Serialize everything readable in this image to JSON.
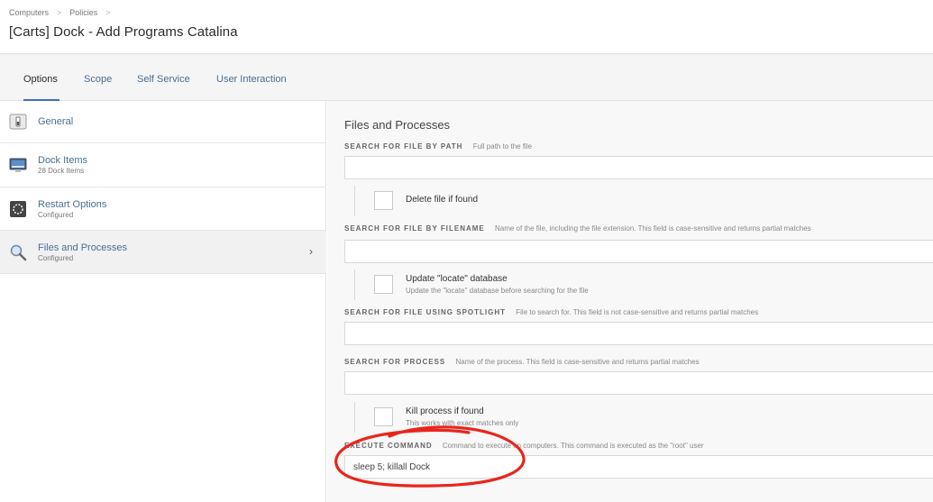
{
  "breadcrumb": {
    "items": [
      "Computers",
      "Policies"
    ],
    "separator": ">"
  },
  "page_title": "[Carts] Dock - Add Programs Catalina",
  "tabs": [
    {
      "label": "Options",
      "active": true
    },
    {
      "label": "Scope",
      "active": false
    },
    {
      "label": "Self Service",
      "active": false
    },
    {
      "label": "User Interaction",
      "active": false
    }
  ],
  "sidebar": {
    "items": [
      {
        "label": "General",
        "sub": "",
        "icon": "general-switch-icon"
      },
      {
        "label": "Dock Items",
        "sub": "28 Dock Items",
        "icon": "monitor-icon"
      },
      {
        "label": "Restart Options",
        "sub": "Configured",
        "icon": "restart-icon"
      },
      {
        "label": "Files and Processes",
        "sub": "Configured",
        "icon": "magnifier-icon",
        "active": true,
        "chevron": "›"
      }
    ]
  },
  "main": {
    "section_title": "Files and Processes",
    "search_path": {
      "label": "SEARCH FOR FILE BY PATH",
      "hint": "Full path to the file",
      "value": ""
    },
    "delete_file": {
      "label": "Delete file if found",
      "checked": false
    },
    "search_filename": {
      "label": "SEARCH FOR FILE BY FILENAME",
      "hint": "Name of the file, including the file extension. This field is case-sensitive and returns partial matches",
      "value": ""
    },
    "update_locate": {
      "label": "Update \"locate\" database",
      "sub": "Update the \"locate\" database before searching for the file",
      "checked": false
    },
    "search_spotlight": {
      "label": "SEARCH FOR FILE USING SPOTLIGHT",
      "hint": "File to search for. This field is not case-sensitive and returns partial matches",
      "value": ""
    },
    "search_process": {
      "label": "SEARCH FOR PROCESS",
      "hint": "Name of the process. This field is case-sensitive and returns partial matches",
      "value": ""
    },
    "kill_process": {
      "label": "Kill process if found",
      "sub": "This works with exact matches only",
      "checked": false
    },
    "execute_command": {
      "label": "EXECUTE COMMAND",
      "hint": "Command to execute on computers. This command is executed as the \"root\" user",
      "value": "sleep 5; killall Dock"
    }
  },
  "colors": {
    "link": "#4a6d93",
    "tab_accent": "#3b73b9",
    "annotation": "#e8261c"
  }
}
